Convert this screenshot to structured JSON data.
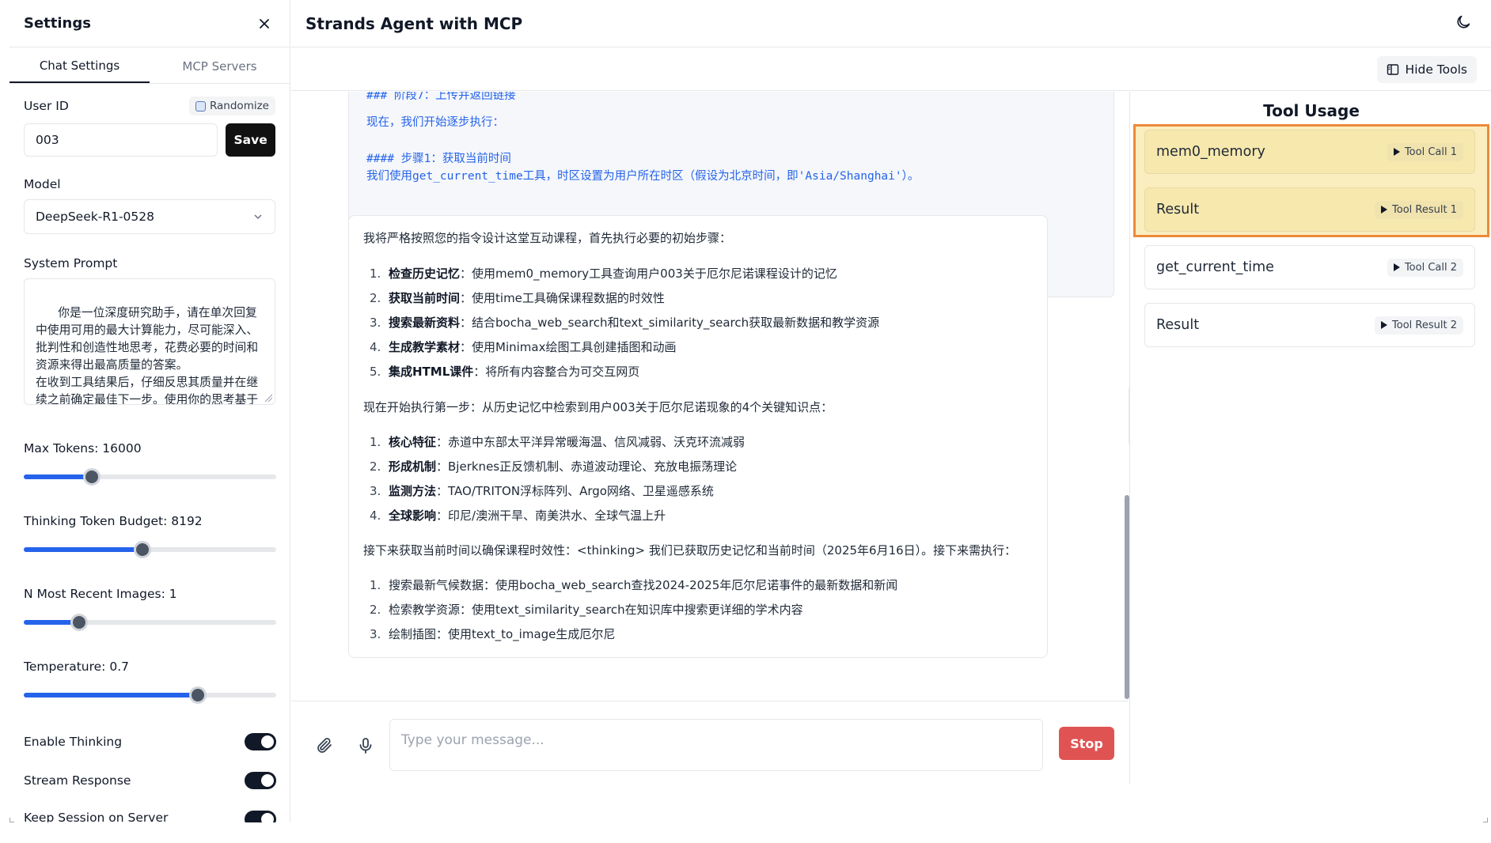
{
  "sidebar": {
    "title": "Settings",
    "tabs": [
      "Chat Settings",
      "MCP Servers"
    ],
    "user_id_label": "User ID",
    "randomize_label": "Randomize",
    "user_id_value": "003",
    "save_label": "Save",
    "model_label": "Model",
    "model_value": "DeepSeek-R1-0528",
    "system_prompt_label": "System Prompt",
    "system_prompt_value": "你是一位深度研究助手，请在单次回复中使用可用的最大计算能力，尽可能深入、批判性和创造性地思考，花费必要的时间和资源来得出最高质量的答案。\n在收到工具结果后，仔细反思其质量并在继续之前确定最佳下一步。使用你的思考基于这些新信息进行规划和迭代，然后采取最佳的下一步行动。",
    "sliders": [
      {
        "label": "Max Tokens: 16000",
        "fraction": 0.27
      },
      {
        "label": "Thinking Token Budget: 8192",
        "fraction": 0.47
      },
      {
        "label": "N Most Recent Images: 1",
        "fraction": 0.22
      },
      {
        "label": "Temperature: 0.7",
        "fraction": 0.69
      }
    ],
    "toggles": [
      {
        "label": "Enable Thinking",
        "on": true
      },
      {
        "label": "Stream Response",
        "on": true
      },
      {
        "label": "Keep Session on Server",
        "on": true
      }
    ]
  },
  "header": {
    "title": "Strands Agent with MCP",
    "hide_tools_label": "Hide Tools"
  },
  "chat": {
    "code_lines": [
      "### 阶段7：上传并返回链接",
      "现在，我们开始逐步执行：",
      "#### 步骤1：获取当前时间",
      "我们使用get_current_time工具，时区设置为用户所在时区（假设为北京时间，即'Asia/Shanghai'）。"
    ],
    "intro": "我将严格按照您的指令设计这堂互动课程，首先执行必要的初始步骤：",
    "list1": [
      {
        "bold": "检查历史记忆",
        "text": "：使用mem0_memory工具查询用户003关于厄尔尼诺课程设计的记忆"
      },
      {
        "bold": "获取当前时间",
        "text": "：使用time工具确保课程数据的时效性"
      },
      {
        "bold": "搜索最新资料",
        "text": "：结合bocha_web_search和text_similarity_search获取最新数据和教学资源"
      },
      {
        "bold": "生成教学素材",
        "text": "：使用Minimax绘图工具创建插图和动画"
      },
      {
        "bold": "集成HTML课件",
        "text": "：将所有内容整合为可交互网页"
      }
    ],
    "para2": "现在开始执行第一步：从历史记忆中检索到用户003关于厄尔尼诺现象的4个关键知识点：",
    "list2": [
      {
        "bold": "核心特征",
        "text": "：赤道中东部太平洋异常暖海温、信风减弱、沃克环流减弱"
      },
      {
        "bold": "形成机制",
        "text": "：Bjerknes正反馈机制、赤道波动理论、充放电振荡理论"
      },
      {
        "bold": "监测方法",
        "text": "：TAO/TRITON浮标阵列、Argo网络、卫星遥感系统"
      },
      {
        "bold": "全球影响",
        "text": "：印尼/澳洲干旱、南美洪水、全球气温上升"
      }
    ],
    "para3": "接下来获取当前时间以确保课程时效性：<thinking> 我们已获取历史记忆和当前时间（2025年6月16日）。接下来需执行：",
    "list3": [
      "搜索最新气候数据：使用bocha_web_search查找2024-2025年厄尔尼诺事件的最新数据和新闻",
      "检索教学资源：使用text_similarity_search在知识库中搜索更详细的学术内容",
      "绘制插图：使用text_to_image生成厄尔尼"
    ],
    "input_placeholder": "Type your message...",
    "stop_label": "Stop"
  },
  "tools": {
    "title": "Tool Usage",
    "items": [
      {
        "name": "mem0_memory",
        "badge": "Tool Call 1",
        "highlighted": true
      },
      {
        "name": "Result",
        "badge": "Tool Result 1",
        "highlighted": true
      },
      {
        "name": "get_current_time",
        "badge": "Tool Call 2",
        "highlighted": false
      },
      {
        "name": "Result",
        "badge": "Tool Result 2",
        "highlighted": false
      }
    ]
  },
  "colors": {
    "accent": "#2563eb",
    "stop": "#e05353",
    "highlight_border": "#ec8a3a",
    "highlight_bg": "#faeebe"
  }
}
